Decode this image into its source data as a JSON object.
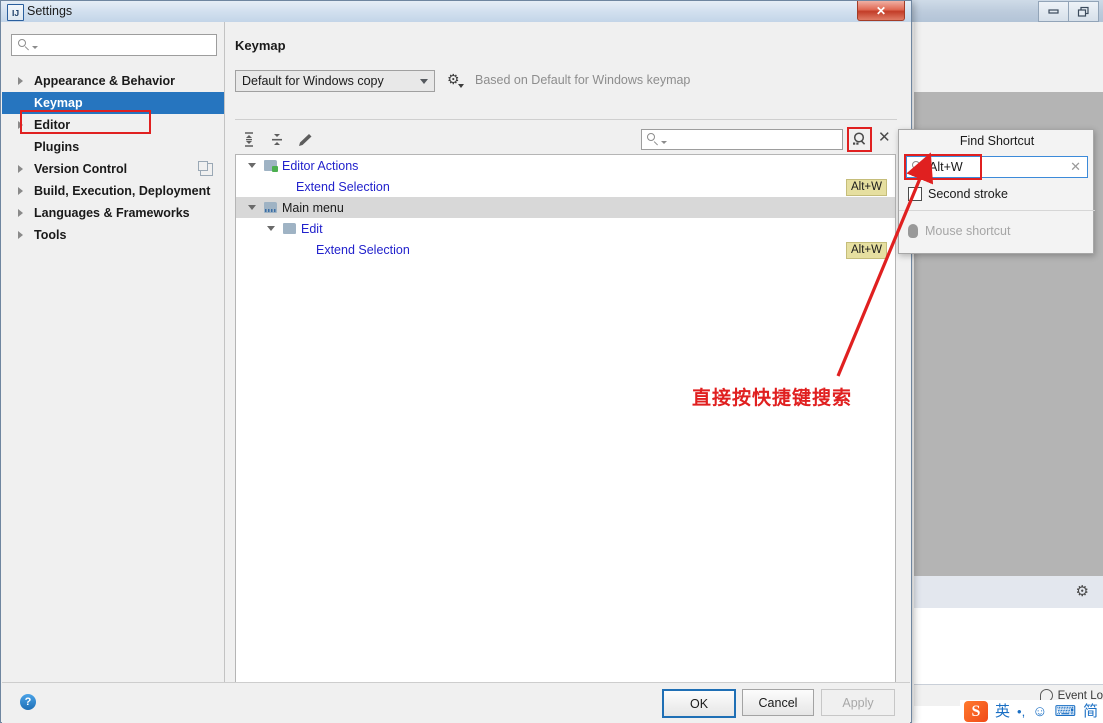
{
  "background_window": {
    "window_controls": [
      "minimize-icon",
      "restore-icon"
    ],
    "gear_icon": "gear-icon",
    "status_bar": {
      "event_log_label": "Event Lo"
    },
    "ime": {
      "logo": "S",
      "items": [
        "英",
        "•,",
        "☺",
        "⌨",
        "简"
      ]
    }
  },
  "dialog": {
    "title": "Settings",
    "app_icon": "IJ",
    "close_label": "✕",
    "sidebar": {
      "search_placeholder": "",
      "search_icon": "search-icon",
      "items": [
        {
          "label": "Appearance & Behavior",
          "expandable": true,
          "selected": false
        },
        {
          "label": "Keymap",
          "expandable": false,
          "selected": true
        },
        {
          "label": "Editor",
          "expandable": true,
          "selected": false
        },
        {
          "label": "Plugins",
          "expandable": false,
          "selected": false
        },
        {
          "label": "Version Control",
          "expandable": true,
          "selected": false,
          "trailing_icon": "copy-icon"
        },
        {
          "label": "Build, Execution, Deployment",
          "expandable": true,
          "selected": false
        },
        {
          "label": "Languages & Frameworks",
          "expandable": true,
          "selected": false
        },
        {
          "label": "Tools",
          "expandable": true,
          "selected": false
        }
      ]
    },
    "content": {
      "page_title": "Keymap",
      "keymap_select": {
        "value": "Default for Windows copy",
        "chevron": "chevron-down-icon"
      },
      "gear_icon": "gear-icon",
      "based_on_text": "Based on Default for Windows keymap",
      "toolbar": {
        "expand_all_icon": "expand-all-icon",
        "collapse_all_icon": "collapse-all-icon",
        "edit_icon": "pencil-edit-icon",
        "search_placeholder": "",
        "search_icon": "search-icon",
        "find_shortcut_icon": "find-shortcut-icon",
        "clear_icon": "close-icon"
      },
      "tree": [
        {
          "label": "Editor Actions",
          "indent": 0,
          "kind": "group",
          "twisty": true,
          "icon": "folder-green-icon",
          "shortcut": "",
          "highlight": false
        },
        {
          "label": "Extend Selection",
          "indent": 2,
          "kind": "action",
          "twisty": false,
          "icon": "",
          "shortcut": "Alt+W",
          "highlight": false
        },
        {
          "label": "Main menu",
          "indent": 0,
          "kind": "group",
          "twisty": true,
          "icon": "folder-menu-icon",
          "shortcut": "",
          "highlight": true
        },
        {
          "label": "Edit",
          "indent": 1,
          "kind": "group",
          "twisty": true,
          "icon": "folder-icon",
          "shortcut": "",
          "highlight": false
        },
        {
          "label": "Extend Selection",
          "indent": 2,
          "kind": "action",
          "twisty": false,
          "icon": "",
          "shortcut": "Alt+W",
          "highlight": false
        }
      ]
    },
    "footer": {
      "help_label": "?",
      "ok_label": "OK",
      "cancel_label": "Cancel",
      "apply_label": "Apply"
    }
  },
  "find_shortcut_popup": {
    "title": "Find Shortcut",
    "search_icon": "search-icon",
    "value": "Alt+W",
    "clear_icon": "close-icon",
    "second_stroke_label": "Second stroke",
    "second_stroke_checked": false,
    "mouse_shortcut_label": "Mouse shortcut",
    "mouse_icon": "mouse-icon"
  },
  "annotation": {
    "text": "直接按快捷键搜索",
    "color": "#e02020",
    "arrow": "arrow-pointing-to-shortcut-input"
  }
}
